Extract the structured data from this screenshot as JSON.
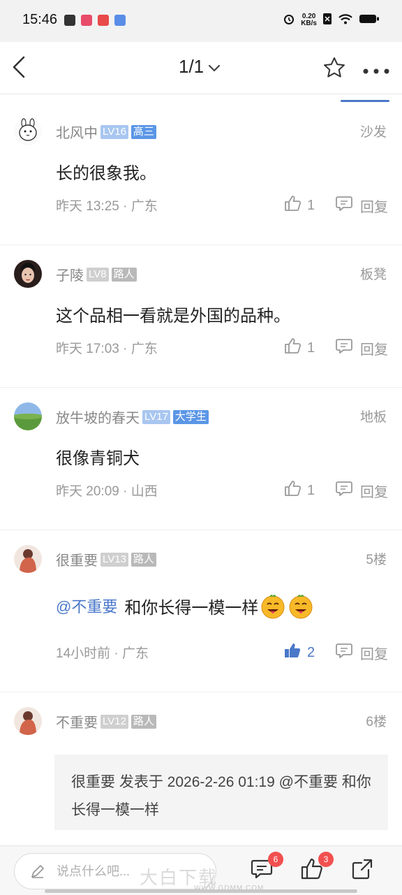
{
  "status_bar": {
    "time": "15:46",
    "net_speed_value": "0.20",
    "net_speed_unit": "KB/s"
  },
  "nav": {
    "page_indicator": "1/1"
  },
  "comments": [
    {
      "username": "北风中",
      "level": "LV16",
      "title": "高三",
      "floor": "沙发",
      "content": "长的很象我。",
      "time": "昨天 13:25",
      "location": "广东",
      "likes": "1",
      "reply_label": "回复"
    },
    {
      "username": "子陵",
      "level": "LV8",
      "title": "路人",
      "floor": "板凳",
      "content": "这个品相一看就是外国的品种。",
      "time": "昨天 17:03",
      "location": "广东",
      "likes": "1",
      "reply_label": "回复"
    },
    {
      "username": "放牛坡的春天",
      "level": "LV17",
      "title": "大学生",
      "floor": "地板",
      "content": "很像青铜犬",
      "time": "昨天 20:09",
      "location": "山西",
      "likes": "1",
      "reply_label": "回复"
    },
    {
      "username": "很重要",
      "level": "LV13",
      "title": "路人",
      "floor": "5楼",
      "mention": "@不重要",
      "content": "和你长得一模一样",
      "time": "14小时前",
      "location": "广东",
      "likes": "2",
      "reply_label": "回复"
    },
    {
      "username": "不重要",
      "level": "LV12",
      "title": "路人",
      "floor": "6楼",
      "quote": "很重要 发表于 2026-2-26 01:19 @不重要 和你长得一模一样"
    }
  ],
  "bottom_bar": {
    "input_placeholder": "说点什么吧...",
    "comment_count": "6",
    "like_count": "3"
  },
  "watermark": {
    "text": "大白下载",
    "sub": "WWW.GDMM.COM"
  },
  "colors": {
    "accent": "#4a78c8",
    "badge_red": "#f25050",
    "level_blue": "#a8c6f0",
    "title_blue": "#5b96e6"
  }
}
